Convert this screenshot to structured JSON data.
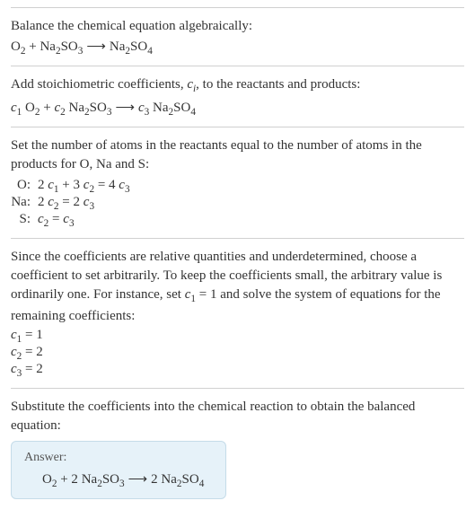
{
  "section1": {
    "intro": "Balance the chemical equation algebraically:",
    "equation_parts": {
      "r1": "O",
      "r1s": "2",
      "plus1": " + ",
      "r2": "Na",
      "r2s": "2",
      "r2b": "SO",
      "r2bs": "3",
      "arrow": "⟶",
      "p1": "Na",
      "p1s": "2",
      "p1b": "SO",
      "p1bs": "4"
    }
  },
  "section2": {
    "intro_a": "Add stoichiometric coefficients, ",
    "ci": "c",
    "ci_sub": "i",
    "intro_b": ", to the reactants and products:",
    "eq": {
      "c1": "c",
      "c1s": "1",
      "sp1": " ",
      "r1": "O",
      "r1s": "2",
      "plus1": " + ",
      "c2": "c",
      "c2s": "2",
      "sp2": " ",
      "r2": "Na",
      "r2s": "2",
      "r2b": "SO",
      "r2bs": "3",
      "arrow": "⟶",
      "c3": "c",
      "c3s": "3",
      "sp3": " ",
      "p1": "Na",
      "p1s": "2",
      "p1b": "SO",
      "p1bs": "4"
    }
  },
  "section3": {
    "intro": "Set the number of atoms in the reactants equal to the number of atoms in the products for O, Na and S:",
    "rows": [
      {
        "label": "O:",
        "lhs_a": "2 ",
        "c1": "c",
        "c1s": "1",
        "plus": " + 3 ",
        "c2": "c",
        "c2s": "2",
        "eq": " = 4 ",
        "c3": "c",
        "c3s": "3"
      },
      {
        "label": "Na:",
        "lhs_a": "2 ",
        "c1": "c",
        "c1s": "2",
        "plus": "",
        "c2": "",
        "c2s": "",
        "eq": " = 2 ",
        "c3": "c",
        "c3s": "3"
      },
      {
        "label": "S:",
        "lhs_a": "",
        "c1": "c",
        "c1s": "2",
        "plus": "",
        "c2": "",
        "c2s": "",
        "eq": " = ",
        "c3": "c",
        "c3s": "3"
      }
    ]
  },
  "section4": {
    "intro_a": "Since the coefficients are relative quantities and underdetermined, choose a coefficient to set arbitrarily. To keep the coefficients small, the arbitrary value is ordinarily one. For instance, set ",
    "c1": "c",
    "c1s": "1",
    "intro_b": " = 1 and solve the system of equations for the remaining coefficients:",
    "coeffs": [
      {
        "c": "c",
        "cs": "1",
        "val": " = 1"
      },
      {
        "c": "c",
        "cs": "2",
        "val": " = 2"
      },
      {
        "c": "c",
        "cs": "3",
        "val": " = 2"
      }
    ]
  },
  "section5": {
    "intro": "Substitute the coefficients into the chemical reaction to obtain the balanced equation:",
    "answer_label": "Answer:",
    "eq": {
      "r1": "O",
      "r1s": "2",
      "plus1": " + 2 ",
      "r2": "Na",
      "r2s": "2",
      "r2b": "SO",
      "r2bs": "3",
      "arrow": "⟶",
      "two": "2 ",
      "p1": "Na",
      "p1s": "2",
      "p1b": "SO",
      "p1bs": "4"
    }
  }
}
